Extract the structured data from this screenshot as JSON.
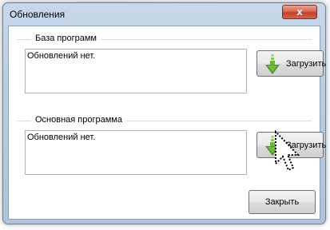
{
  "window": {
    "title": "Обновления",
    "close_glyph": "x"
  },
  "groups": [
    {
      "title": "База программ",
      "text": "Обновлений нет.",
      "button_label": "Загрузить",
      "button_icon": "green-download-arrow-icon"
    },
    {
      "title": "Основная программа",
      "text": "Обновлений нет.",
      "button_label": "Загрузить",
      "button_icon": "green-download-arrow-icon"
    }
  ],
  "footer": {
    "close_label": "Закрыть"
  },
  "colors": {
    "accent_green": "#5aa829",
    "close_red": "#c4402a"
  }
}
